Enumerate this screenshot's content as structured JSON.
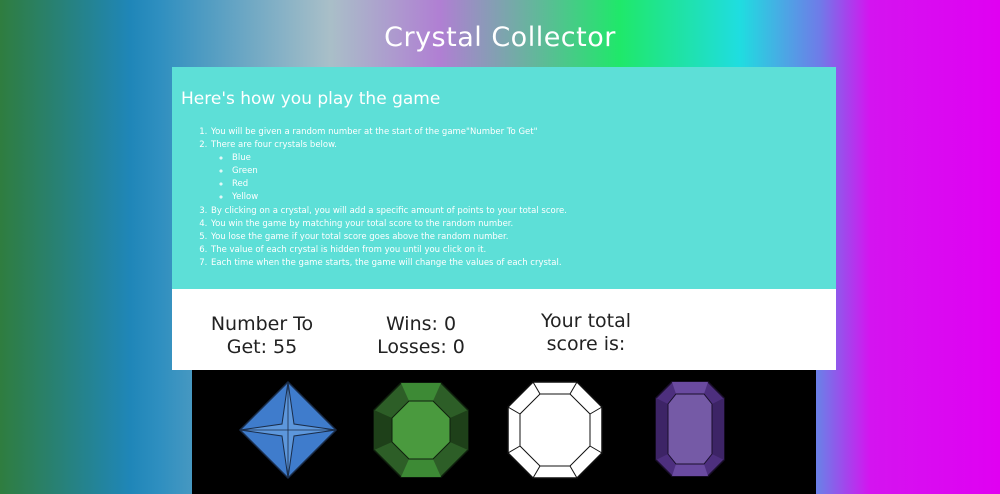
{
  "title": "Crystal Collector",
  "instructions": {
    "heading": "Here's how you play the game",
    "steps": [
      "You will be given a random number at the start of the game\"Number To Get\"",
      "There are four crystals below.",
      "By clicking on a crystal, you will add a specific amount of points to your total score.",
      "You win the game by matching your total score to the random number.",
      "You lose the game if your total score goes above the random number.",
      "The value of each crystal is hidden from you until you click on it.",
      "Each time when the game starts, the game will change the values of each crystal."
    ],
    "crystal_colors": [
      "Blue",
      "Green",
      "Red",
      "Yellow"
    ]
  },
  "scoreboard": {
    "target_line1": "Number To",
    "target_line2": "Get: 55",
    "wins": "Wins: 0",
    "losses": "Losses: 0",
    "total_line1": "Your total",
    "total_line2": "score is:"
  },
  "crystals": [
    {
      "name": "blue-crystal",
      "color": "#3f7ccc"
    },
    {
      "name": "green-crystal",
      "color": "#3d8a35"
    },
    {
      "name": "white-crystal",
      "color": "#ffffff"
    },
    {
      "name": "purple-crystal",
      "color": "#6a4aa0"
    }
  ],
  "colors": {
    "instructions_bg": "#5ddfd7",
    "board_bg": "#000000",
    "score_bg": "#ffffff"
  }
}
